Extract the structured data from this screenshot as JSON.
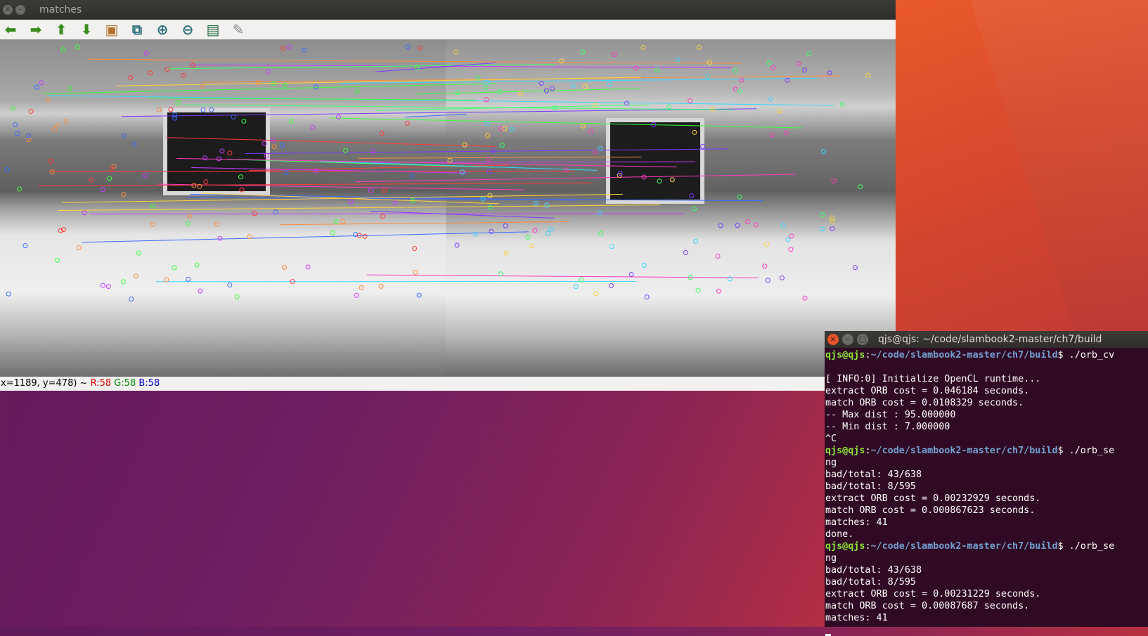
{
  "viewer": {
    "title": "matches",
    "toolbar": [
      {
        "name": "pan-left",
        "icon": "arrow-left-icon",
        "glyph": "⬅",
        "color": "#3a8c1c"
      },
      {
        "name": "pan-right",
        "icon": "arrow-right-icon",
        "glyph": "➡",
        "color": "#3a8c1c"
      },
      {
        "name": "pan-up",
        "icon": "arrow-up-icon",
        "glyph": "⬆",
        "color": "#3a8c1c"
      },
      {
        "name": "pan-down",
        "icon": "arrow-down-icon",
        "glyph": "⬇",
        "color": "#3a8c1c"
      },
      {
        "name": "zoom-original",
        "icon": "image-icon",
        "glyph": "▣",
        "color": "#b5722b"
      },
      {
        "name": "zoom-fit",
        "icon": "image-zoom-icon",
        "glyph": "⧉",
        "color": "#2a6d7a"
      },
      {
        "name": "zoom-in",
        "icon": "zoom-in-icon",
        "glyph": "⊕",
        "color": "#2a6d7a"
      },
      {
        "name": "zoom-out",
        "icon": "zoom-out-icon",
        "glyph": "⊖",
        "color": "#2a6d7a"
      },
      {
        "name": "save",
        "icon": "save-icon",
        "glyph": "▤",
        "color": "#1d6b3a"
      },
      {
        "name": "properties",
        "icon": "brush-icon",
        "glyph": "✎",
        "color": "#8a8a8a"
      }
    ],
    "status": {
      "coords": "x=1189, y=478) ~ ",
      "r": "R:58",
      "g": "G:58",
      "b": "B:58"
    }
  },
  "terminal": {
    "title": "qjs@qjs: ~/code/slambook2-master/ch7/build",
    "lines": [
      {
        "user": "qjs@qjs",
        "path": "~/code/slambook2-master/ch7/build",
        "cmd": "$ ./orb_cv"
      },
      {
        "text": ""
      },
      {
        "text": "[ INFO:0] Initialize OpenCL runtime..."
      },
      {
        "text": "extract ORB cost = 0.046184 seconds."
      },
      {
        "text": "match ORB cost = 0.0108329 seconds."
      },
      {
        "text": "-- Max dist : 95.000000"
      },
      {
        "text": "-- Min dist : 7.000000"
      },
      {
        "text": "^C"
      },
      {
        "user": "qjs@qjs",
        "path": "~/code/slambook2-master/ch7/build",
        "cmd": "$ ./orb_se"
      },
      {
        "text": "ng"
      },
      {
        "text": "bad/total: 43/638"
      },
      {
        "text": "bad/total: 8/595"
      },
      {
        "text": "extract ORB cost = 0.00232929 seconds."
      },
      {
        "text": "match ORB cost = 0.000867623 seconds."
      },
      {
        "text": "matches: 41"
      },
      {
        "text": "done."
      },
      {
        "user": "qjs@qjs",
        "path": "~/code/slambook2-master/ch7/build",
        "cmd": "$ ./orb_se"
      },
      {
        "text": "ng"
      },
      {
        "text": "bad/total: 43/638"
      },
      {
        "text": "bad/total: 8/595"
      },
      {
        "text": "extract ORB cost = 0.00231229 seconds."
      },
      {
        "text": "match ORB cost = 0.00087687 seconds."
      },
      {
        "text": "matches: 41"
      }
    ]
  }
}
